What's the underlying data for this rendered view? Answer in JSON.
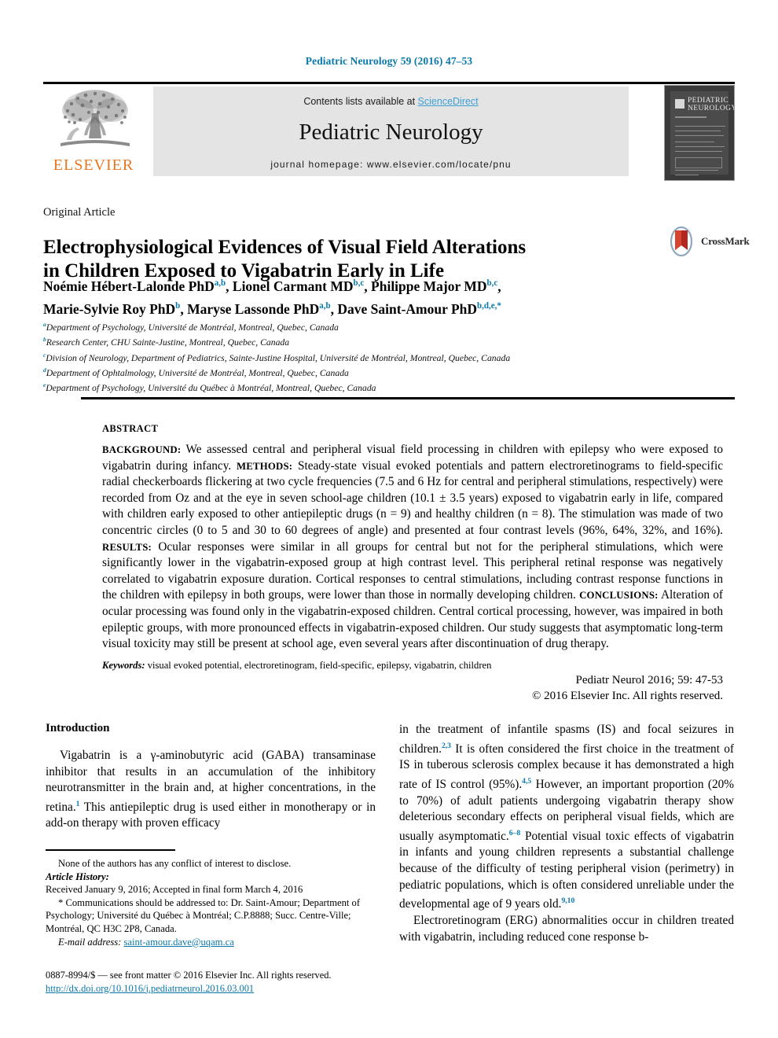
{
  "running_head": "Pediatric Neurology 59 (2016) 47–53",
  "masthead": {
    "contents_prefix": "Contents lists available at ",
    "sciencedirect_link": "ScienceDirect",
    "journal_title": "Pediatric Neurology",
    "homepage_line": "journal homepage: www.elsevier.com/locate/pnu",
    "publisher_name": "ELSEVIER",
    "cover": {
      "line1": "PEDIATRIC",
      "line2": "NEUROLOGY"
    }
  },
  "article": {
    "type": "Original Article",
    "title_line1": "Electrophysiological Evidences of Visual Field Alterations",
    "title_line2": "in Children Exposed to Vigabatrin Early in Life",
    "crossmark_label": "CrossMark",
    "authors_line1_pre": "Noémie Hébert-Lalonde PhD",
    "authors": "Noémie Hébert-Lalonde PhD a,b, Lionel Carmant MD b,c, Philippe Major MD b,c, Marie-Sylvie Roy PhD b, Maryse Lassonde PhD a,b, Dave Saint-Amour PhD b,d,e,*",
    "affiliations": [
      {
        "mark": "a",
        "text": "Department of Psychology, Université de Montréal, Montreal, Quebec, Canada"
      },
      {
        "mark": "b",
        "text": "Research Center, CHU Sainte-Justine, Montreal, Quebec, Canada"
      },
      {
        "mark": "c",
        "text": "Division of Neurology, Department of Pediatrics, Sainte-Justine Hospital, Université de Montréal, Montreal, Quebec, Canada"
      },
      {
        "mark": "d",
        "text": "Department of Ophtalmology, Université de Montréal, Montreal, Quebec, Canada"
      },
      {
        "mark": "e",
        "text": "Department of Psychology, Université du Québec à Montréal, Montreal, Quebec, Canada"
      }
    ]
  },
  "abstract": {
    "heading": "ABSTRACT",
    "background_label": "BACKGROUND:",
    "background_text": " We assessed central and peripheral visual field processing in children with epilepsy who were exposed to vigabatrin during infancy. ",
    "methods_label": "METHODS:",
    "methods_text": " Steady-state visual evoked potentials and pattern electroretinograms to field-specific radial checkerboards flickering at two cycle frequencies (7.5 and 6 Hz for central and peripheral stimulations, respectively) were recorded from Oz and at the eye in seven school-age children (10.1 ± 3.5 years) exposed to vigabatrin early in life, compared with children early exposed to other antiepileptic drugs (n = 9) and healthy children (n = 8). The stimulation was made of two concentric circles (0 to 5 and 30 to 60 degrees of angle) and presented at four contrast levels (96%, 64%, 32%, and 16%). ",
    "results_label": "RESULTS:",
    "results_text": " Ocular responses were similar in all groups for central but not for the peripheral stimulations, which were significantly lower in the vigabatrin-exposed group at high contrast level. This peripheral retinal response was negatively correlated to vigabatrin exposure duration. Cortical responses to central stimulations, including contrast response functions in the children with epilepsy in both groups, were lower than those in normally developing children. ",
    "conclusions_label": "CONCLUSIONS:",
    "conclusions_text": " Alteration of ocular processing was found only in the vigabatrin-exposed children. Central cortical processing, however, was impaired in both epileptic groups, with more pronounced effects in vigabatrin-exposed children. Our study suggests that asymptomatic long-term visual toxicity may still be present at school age, even several years after discontinuation of drug therapy.",
    "keywords_label": "Keywords:",
    "keywords_text": " visual evoked potential, electroretinogram, field-specific, epilepsy, vigabatrin, children",
    "citation": "Pediatr Neurol 2016; 59: 47-53",
    "copyright": "© 2016 Elsevier Inc. All rights reserved."
  },
  "body": {
    "section_heading": "Introduction",
    "left_paragraph_1": "Vigabatrin is a γ-aminobutyric acid (GABA) transaminase inhibitor that results in an accumulation of the inhibitory neurotransmitter in the brain and, at higher concentrations, in the retina.",
    "left_paragraph_1_ref": "1",
    "left_paragraph_1_cont": " This antiepileptic drug is used either in monotherapy or in add-on therapy with proven efficacy",
    "right_paragraph_1_a": "in the treatment of infantile spasms (IS) and focal seizures in children.",
    "right_ref_1": "2,3",
    "right_paragraph_1_b": " It is often considered the first choice in the treatment of IS in tuberous sclerosis complex because it has demonstrated a high rate of IS control (95%).",
    "right_ref_2": "4,5",
    "right_paragraph_1_c": " However, an important proportion (20% to 70%) of adult patients undergoing vigabatrin therapy show deleterious secondary effects on peripheral visual fields, which are usually asymptomatic.",
    "right_ref_3": "6–8",
    "right_paragraph_1_d": " Potential visual toxic effects of vigabatrin in infants and young children represents a substantial challenge because of the difficulty of testing peripheral vision (perimetry) in pediatric populations, which is often considered unreliable under the developmental age of 9 years old.",
    "right_ref_4": "9,10",
    "right_paragraph_2_a": "Electroretinogram (ERG) abnormalities occur in children treated with vigabatrin, including reduced cone response b-"
  },
  "footnotes": {
    "conflict": "None of the authors has any conflict of interest to disclose.",
    "history_label": "Article History:",
    "history_text": "Received January 9, 2016; Accepted in final form March 4, 2016",
    "correspondence": "* Communications should be addressed to: Dr. Saint-Amour; Department of Psychology; Université du Québec à Montréal; C.P.8888; Succ. Centre-Ville; Montréal, QC H3C 2P8, Canada.",
    "email_label": "E-mail address:",
    "email_value": "saint-amour.dave@uqam.ca",
    "issn_line": "0887-8994/$ — see front matter © 2016 Elsevier Inc. All rights reserved.",
    "doi_line": "http://dx.doi.org/10.1016/j.pediatrneurol.2016.03.001"
  },
  "colors": {
    "link_blue": "#0b78ab",
    "sciencedirect_blue": "#3c9fd6",
    "elsevier_orange": "#e87722",
    "banner_gray": "#e4e4e4"
  }
}
